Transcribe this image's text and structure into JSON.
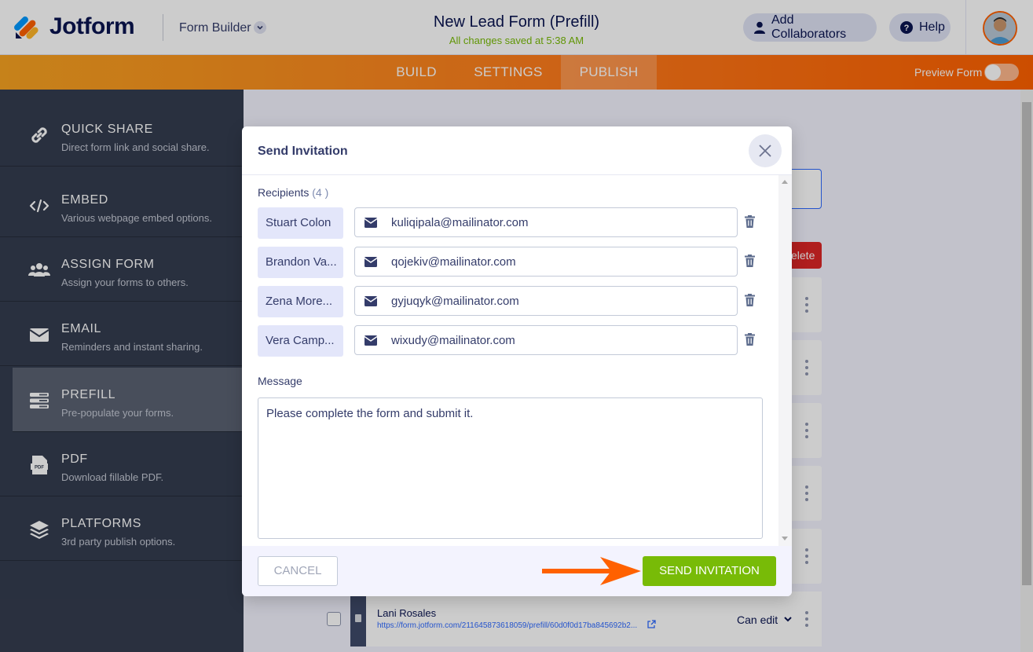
{
  "header": {
    "logo_text": "Jotform",
    "builder_label": "Form Builder",
    "form_title": "New Lead Form (Prefill)",
    "saved_status": "All changes saved at 5:38 AM",
    "add_collaborators": "Add Collaborators",
    "help": "Help"
  },
  "nav": {
    "tabs": [
      {
        "label": "BUILD"
      },
      {
        "label": "SETTINGS"
      },
      {
        "label": "PUBLISH",
        "active": true
      }
    ],
    "preview_label": "Preview Form",
    "preview_on": false
  },
  "sidebar": {
    "items": [
      {
        "title": "QUICK SHARE",
        "desc": "Direct form link and social share.",
        "icon": "link-icon"
      },
      {
        "title": "EMBED",
        "desc": "Various webpage embed options.",
        "icon": "code-icon"
      },
      {
        "title": "ASSIGN FORM",
        "desc": "Assign your forms to others.",
        "icon": "users-icon"
      },
      {
        "title": "EMAIL",
        "desc": "Reminders and instant sharing.",
        "icon": "envelope-icon"
      },
      {
        "title": "PREFILL",
        "desc": "Pre-populate your forms.",
        "icon": "prefill-icon",
        "active": true
      },
      {
        "title": "PDF",
        "desc": "Download fillable PDF.",
        "icon": "pdf-icon"
      },
      {
        "title": "PLATFORMS",
        "desc": "3rd party publish options.",
        "icon": "layers-icon"
      }
    ]
  },
  "background": {
    "delete_label": "elete",
    "last_row": {
      "name": "Lani Rosales",
      "link": "https://form.jotform.com/211645873618059/prefill/60d0f0d17ba845692b2...",
      "permission": "Can edit"
    }
  },
  "modal": {
    "title": "Send Invitation",
    "recipients_label": "Recipients",
    "recipients_count": "(4 )",
    "recipients": [
      {
        "name": "Stuart Colon",
        "email": "kuliqipala@mailinator.com"
      },
      {
        "name": "Brandon Va...",
        "email": "qojekiv@mailinator.com"
      },
      {
        "name": "Zena More...",
        "email": "gyjuqyk@mailinator.com"
      },
      {
        "name": "Vera Camp...",
        "email": "wixudy@mailinator.com"
      }
    ],
    "message_label": "Message",
    "message_text": "Please complete the form and submit it.",
    "cancel_label": "CANCEL",
    "send_label": "SEND INVITATION"
  },
  "colors": {
    "brand_orange": "#ff6100",
    "accent_green": "#78bb07",
    "sidebar_bg": "#343c4f",
    "danger": "#dc2626",
    "link_blue": "#2e69ff"
  }
}
